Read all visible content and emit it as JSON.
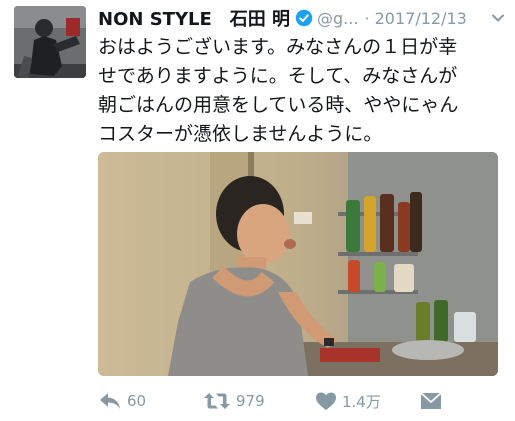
{
  "tweet": {
    "display_name": "NON STYLE　石田 明",
    "handle": "@g...",
    "timestamp": "· 2017/12/13",
    "text_lines": [
      "おはようございます。みなさんの１日が幸",
      "せでありますように。そして、みなさんが",
      "朝ごはんの用意をしている時、ややにゃん",
      "コスターが憑依しませんように。"
    ]
  },
  "actions": {
    "reply": {
      "icon": "reply-icon",
      "count": "60"
    },
    "retweet": {
      "icon": "retweet-icon",
      "count": "979"
    },
    "like": {
      "icon": "heart-icon",
      "count": "1.4万"
    },
    "message": {
      "icon": "envelope-icon"
    }
  },
  "colors": {
    "text": "#14171a",
    "muted": "#8899a6",
    "verified": "#1da1f2"
  }
}
